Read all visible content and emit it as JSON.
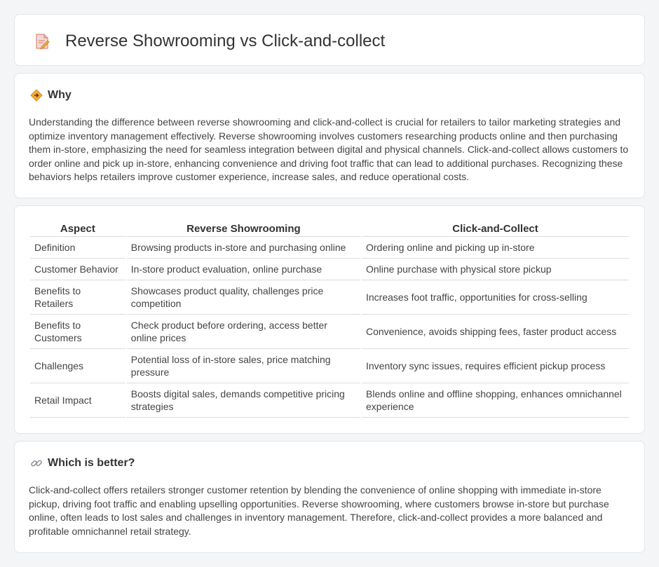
{
  "header": {
    "title": "Reverse Showrooming vs Click-and-collect",
    "icon": "document-pencil-icon"
  },
  "why": {
    "heading": "Why",
    "icon": "diamond-warning-icon",
    "text": "Understanding the difference between reverse showrooming and click-and-collect is crucial for retailers to tailor marketing strategies and optimize inventory management effectively. Reverse showrooming involves customers researching products online and then purchasing them in-store, emphasizing the need for seamless integration between digital and physical channels. Click-and-collect allows customers to order online and pick up in-store, enhancing convenience and driving foot traffic that can lead to additional purchases. Recognizing these behaviors helps retailers improve customer experience, increase sales, and reduce operational costs."
  },
  "table": {
    "headers": [
      "Aspect",
      "Reverse Showrooming",
      "Click-and-Collect"
    ],
    "rows": [
      [
        "Definition",
        "Browsing products in-store and purchasing online",
        "Ordering online and picking up in-store"
      ],
      [
        "Customer Behavior",
        "In-store product evaluation, online purchase",
        "Online purchase with physical store pickup"
      ],
      [
        "Benefits to Retailers",
        "Showcases product quality, challenges price competition",
        "Increases foot traffic, opportunities for cross-selling"
      ],
      [
        "Benefits to Customers",
        "Check product before ordering, access better online prices",
        "Convenience, avoids shipping fees, faster product access"
      ],
      [
        "Challenges",
        "Potential loss of in-store sales, price matching pressure",
        "Inventory sync issues, requires efficient pickup process"
      ],
      [
        "Retail Impact",
        "Boosts digital sales, demands competitive pricing strategies",
        "Blends online and offline shopping, enhances omnichannel experience"
      ]
    ]
  },
  "better": {
    "heading": "Which is better?",
    "icon": "link-icon",
    "text": "Click-and-collect offers retailers stronger customer retention by blending the convenience of online shopping with immediate in-store pickup, driving foot traffic and enabling upselling opportunities. Reverse showrooming, where customers browse in-store but purchase online, often leads to lost sales and challenges in inventory management. Therefore, click-and-collect provides a more balanced and profitable omnichannel retail strategy."
  },
  "colors": {
    "accent_orange": "#f2a93b",
    "icon_pink": "#e98a7a",
    "border": "#e3e5e8"
  }
}
